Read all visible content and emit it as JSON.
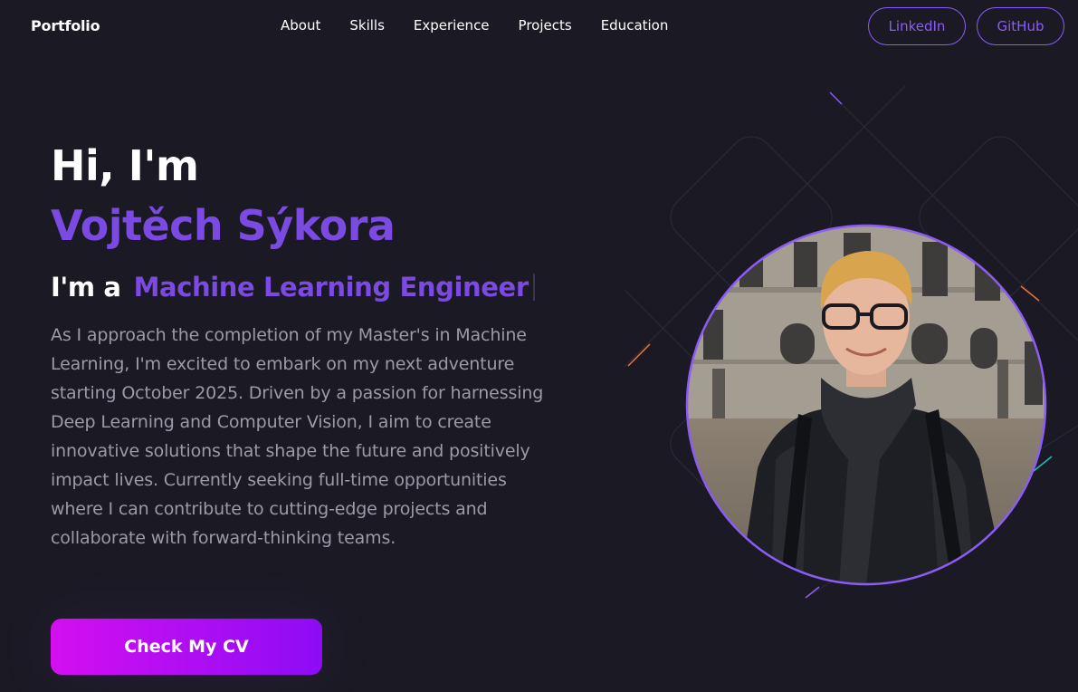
{
  "nav": {
    "logo": "Portfolio",
    "links": [
      "About",
      "Skills",
      "Experience",
      "Projects",
      "Education"
    ],
    "linkedin": "LinkedIn",
    "github": "GitHub"
  },
  "hero": {
    "greeting": "Hi, I'm",
    "name": "Vojtěch Sýkora",
    "role_prefix": "I'm a",
    "role": "Machine Learning Engineer",
    "bio": "As I approach the completion of my Master's in Machine Learning, I'm excited to embark on my next adventure starting October 2025. Driven by a passion for harnessing Deep Learning and Computer Vision, I aim to create innovative solutions that shape the future and positively impact lives. Currently seeking full-time opportunities where I can contribute to cutting-edge projects and collaborate with forward-thinking teams.",
    "cv_button": "Check My CV"
  },
  "colors": {
    "background": "#1b1a24",
    "accent": "#7b4ae2",
    "button_gradient_start": "#d40ff0",
    "button_gradient_end": "#8d0cf5"
  }
}
